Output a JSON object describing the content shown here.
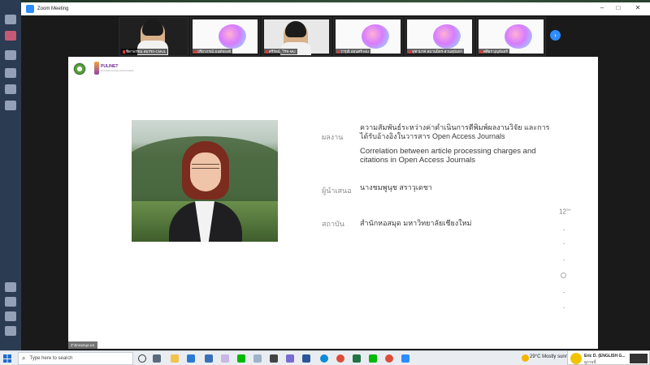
{
  "window": {
    "title": "Zoom Meeting",
    "controls": [
      "–",
      "□",
      "✕"
    ]
  },
  "gallery": {
    "tiles": [
      {
        "name": "ชิดาพรรณ สมรรถ-CMUL",
        "kind": "camera"
      },
      {
        "name": "ปรียาภรณ์ มนต์ทองดี",
        "kind": "slide"
      },
      {
        "name": "ศรีรัตน์_วิรัช-MU",
        "kind": "camera"
      },
      {
        "name": "วารุณี อ่อนศรี-MU",
        "kind": "slide"
      },
      {
        "name": "จุฑามาศ สมานมิตร-สวนสุนันทา",
        "kind": "slide"
      },
      {
        "name": "ศศิธร บุญจันทร์",
        "kind": "slide"
      }
    ],
    "next_label": "›"
  },
  "slide": {
    "org_logo": "PULINET",
    "org_sub": "Provincial University Library Network",
    "work_label": "ผลงาน",
    "work_title_th": "ความสัมพันธ์ระหว่างค่าดำเนินการตีพิมพ์ผลงานวิจัย และการได้รับอ้างอิงในวารสาร Open Access Journals",
    "work_title_en": "Correlation between article processing charges and citations in Open Access Journals",
    "presenter_label": "ผู้นำเสนอ",
    "presenter_name": "นางชมพูนุช  สราวุเดชา",
    "institution_label": "สถาบัน",
    "institution_name": "สำนักหอสมุด มหาวิทยาลัยเชียงใหม่",
    "conference_number": "12",
    "conference_suffix": "TH",
    "tag": "สำนักหอสมุด มช."
  },
  "taskbar": {
    "search_placeholder": "Type here to search",
    "weather": "29°C  Mostly sunny"
  },
  "toast": {
    "name": "Eric D. (ENGLISH G...",
    "message": "ดูภาพนี้"
  }
}
